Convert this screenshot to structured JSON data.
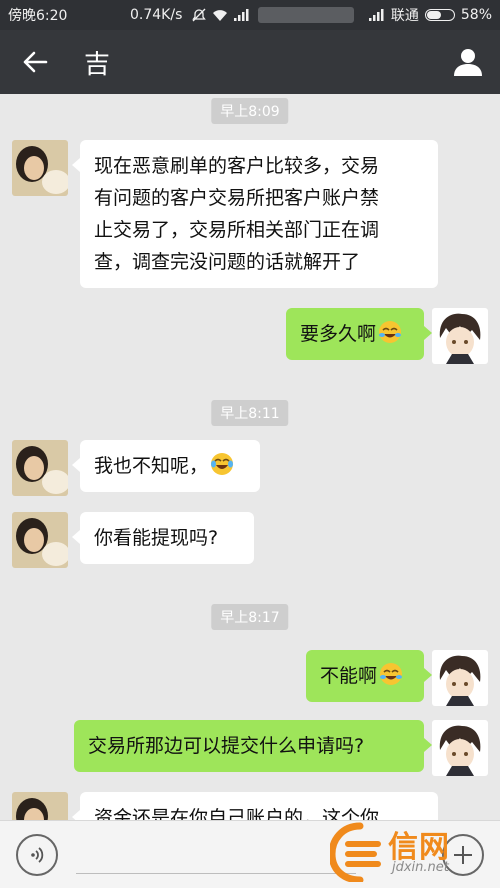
{
  "status_bar": {
    "time": "傍晚6:20",
    "speed": "0.74K/s",
    "carrier": "联通",
    "battery": "58%",
    "battery_level": 0.58
  },
  "header": {
    "title": "吉",
    "back_icon": "back-arrow-icon",
    "profile_icon": "person-icon"
  },
  "messages": [
    {
      "type": "time",
      "text": "早上8:09"
    },
    {
      "type": "incoming",
      "lines": [
        "现在恶意刷单的客户比较多，交易",
        "有问题的客户交易所把客户账户禁",
        "止交易了，交易所相关部门正在调",
        "查，调查完没问题的话就解开了"
      ]
    },
    {
      "type": "outgoing",
      "text": "要多久啊",
      "emoji": "crying-laughing-emoji"
    },
    {
      "type": "time",
      "text": "早上8:11"
    },
    {
      "type": "incoming",
      "text": "我也不知呢，",
      "emoji": "tears-of-joy-emoji"
    },
    {
      "type": "incoming",
      "text": "你看能提现吗?"
    },
    {
      "type": "time",
      "text": "早上8:17"
    },
    {
      "type": "outgoing",
      "text": "不能啊",
      "emoji": "crying-laughing-emoji"
    },
    {
      "type": "outgoing",
      "text": "交易所那边可以提交什么申请吗?"
    },
    {
      "type": "incoming",
      "text": "资金还是在你自己账户的，这个你"
    }
  ],
  "watermark": {
    "name": "信网",
    "url": "jdxin.net"
  },
  "colors": {
    "outgoing_bubble": "#9ee55a",
    "incoming_bubble": "#ffffff",
    "header": "#35373b"
  }
}
